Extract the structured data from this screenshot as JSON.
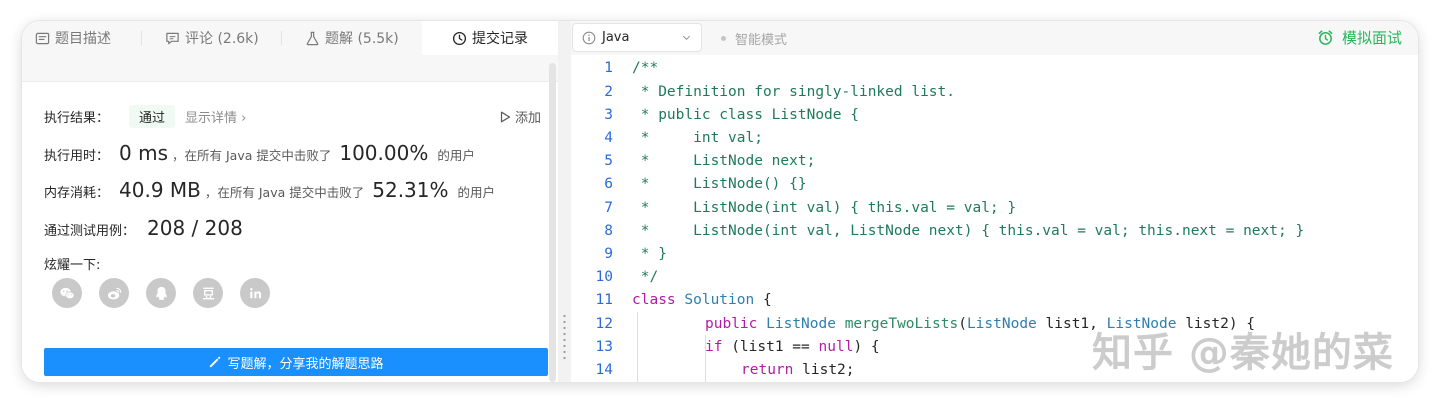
{
  "tabs": [
    {
      "label": "题目描述",
      "icon": "description-icon"
    },
    {
      "label": "评论 (2.6k)",
      "icon": "comment-icon"
    },
    {
      "label": "题解 (5.5k)",
      "icon": "flask-icon"
    },
    {
      "label": "提交记录",
      "icon": "clock-icon"
    }
  ],
  "result": {
    "exec_label": "执行结果：",
    "status": "通过",
    "detail_link": "显示详情 ›",
    "add_label": "添加",
    "time_label": "执行用时：",
    "time_value": "0 ms",
    "time_text": "，在所有 Java 提交中击败了",
    "time_pct": "100.00%",
    "time_suffix": "的用户",
    "mem_label": "内存消耗：",
    "mem_value": "40.9 MB",
    "mem_text": "，在所有 Java 提交中击败了",
    "mem_pct": "52.31%",
    "mem_suffix": "的用户",
    "tests_label": "通过测试用例：",
    "tests_value": "208 / 208",
    "share_label": "炫耀一下:",
    "share_icons": [
      "wechat-icon",
      "weibo-icon",
      "qq-icon",
      "douban-icon",
      "linkedin-icon"
    ],
    "write_button": "写题解，分享我的解题思路"
  },
  "toolbar": {
    "language": "Java",
    "smart_mode": "智能模式",
    "mock_interview": "模拟面试"
  },
  "code_lines": [
    {
      "n": "1",
      "text": "/**"
    },
    {
      "n": "2",
      "text": " * Definition for singly-linked list."
    },
    {
      "n": "3",
      "text": " * public class ListNode {"
    },
    {
      "n": "4",
      "text": " *     int val;"
    },
    {
      "n": "5",
      "text": " *     ListNode next;"
    },
    {
      "n": "6",
      "text": " *     ListNode() {}"
    },
    {
      "n": "7",
      "text": " *     ListNode(int val) { this.val = val; }"
    },
    {
      "n": "8",
      "text": " *     ListNode(int val, ListNode next) { this.val = val; this.next = next; }"
    },
    {
      "n": "9",
      "text": " * }"
    },
    {
      "n": "10",
      "text": " */"
    },
    {
      "n": "11",
      "text": "class Solution {"
    },
    {
      "n": "12",
      "text": "    public ListNode mergeTwoLists(ListNode list1, ListNode list2) {"
    },
    {
      "n": "13",
      "text": "        if (list1 == null) {"
    },
    {
      "n": "14",
      "text": "            return list2;"
    }
  ],
  "watermark": "知乎 @秦她的菜",
  "colors": {
    "accent_blue": "#1a90ff",
    "success_green": "#2db55d",
    "line_number_blue": "#2a6bd9"
  }
}
